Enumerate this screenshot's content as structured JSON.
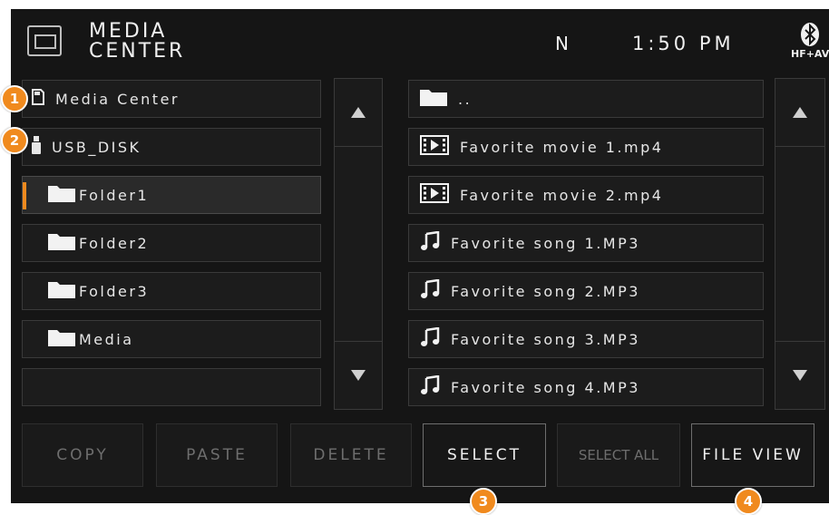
{
  "header": {
    "title_line1": "MEDIA",
    "title_line2": "CENTER",
    "gear": "N",
    "time": "1:50 PM",
    "bt_label": "HF+AV"
  },
  "left_list": [
    {
      "label": "Media Center",
      "icon": "sd-card-icon"
    },
    {
      "label": "USB_DISK",
      "icon": "usb-icon"
    },
    {
      "label": "Folder1",
      "icon": "folder-icon",
      "selected": true
    },
    {
      "label": "Folder2",
      "icon": "folder-icon"
    },
    {
      "label": "Folder3",
      "icon": "folder-icon"
    },
    {
      "label": "Media",
      "icon": "folder-icon"
    },
    {
      "label": "",
      "icon": ""
    }
  ],
  "right_list": [
    {
      "label": "..",
      "icon": "folder-icon"
    },
    {
      "label": "Favorite movie 1.mp4",
      "icon": "video-icon"
    },
    {
      "label": "Favorite movie 2.mp4",
      "icon": "video-icon"
    },
    {
      "label": "Favorite song 1.MP3",
      "icon": "music-note-icon"
    },
    {
      "label": "Favorite song 2.MP3",
      "icon": "music-note-icon"
    },
    {
      "label": "Favorite song 3.MP3",
      "icon": "music-note-icon"
    },
    {
      "label": "Favorite song 4.MP3",
      "icon": "music-note-icon"
    }
  ],
  "toolbar": {
    "copy": "COPY",
    "paste": "PASTE",
    "delete": "DELETE",
    "select": "SELECT",
    "select_all": "SELECT ALL",
    "file_view": "FILE VIEW"
  },
  "badges": [
    "1",
    "2",
    "3",
    "4"
  ],
  "colors": {
    "accent": "#f08a1e",
    "background": "#111111"
  }
}
